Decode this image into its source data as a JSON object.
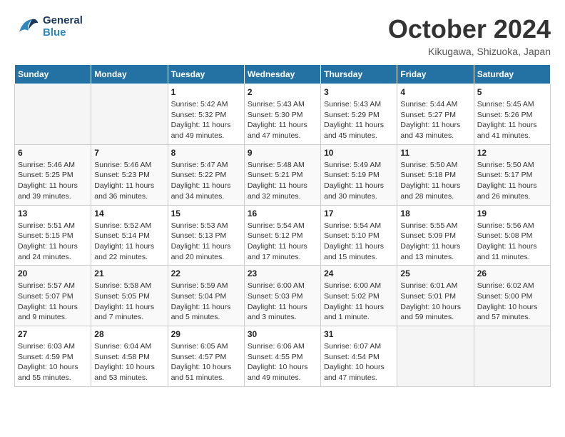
{
  "header": {
    "logo_general": "General",
    "logo_blue": "Blue",
    "title": "October 2024",
    "location": "Kikugawa, Shizuoka, Japan"
  },
  "weekdays": [
    "Sunday",
    "Monday",
    "Tuesday",
    "Wednesday",
    "Thursday",
    "Friday",
    "Saturday"
  ],
  "weeks": [
    [
      {
        "day": "",
        "info": ""
      },
      {
        "day": "",
        "info": ""
      },
      {
        "day": "1",
        "info": "Sunrise: 5:42 AM\nSunset: 5:32 PM\nDaylight: 11 hours and 49 minutes."
      },
      {
        "day": "2",
        "info": "Sunrise: 5:43 AM\nSunset: 5:30 PM\nDaylight: 11 hours and 47 minutes."
      },
      {
        "day": "3",
        "info": "Sunrise: 5:43 AM\nSunset: 5:29 PM\nDaylight: 11 hours and 45 minutes."
      },
      {
        "day": "4",
        "info": "Sunrise: 5:44 AM\nSunset: 5:27 PM\nDaylight: 11 hours and 43 minutes."
      },
      {
        "day": "5",
        "info": "Sunrise: 5:45 AM\nSunset: 5:26 PM\nDaylight: 11 hours and 41 minutes."
      }
    ],
    [
      {
        "day": "6",
        "info": "Sunrise: 5:46 AM\nSunset: 5:25 PM\nDaylight: 11 hours and 39 minutes."
      },
      {
        "day": "7",
        "info": "Sunrise: 5:46 AM\nSunset: 5:23 PM\nDaylight: 11 hours and 36 minutes."
      },
      {
        "day": "8",
        "info": "Sunrise: 5:47 AM\nSunset: 5:22 PM\nDaylight: 11 hours and 34 minutes."
      },
      {
        "day": "9",
        "info": "Sunrise: 5:48 AM\nSunset: 5:21 PM\nDaylight: 11 hours and 32 minutes."
      },
      {
        "day": "10",
        "info": "Sunrise: 5:49 AM\nSunset: 5:19 PM\nDaylight: 11 hours and 30 minutes."
      },
      {
        "day": "11",
        "info": "Sunrise: 5:50 AM\nSunset: 5:18 PM\nDaylight: 11 hours and 28 minutes."
      },
      {
        "day": "12",
        "info": "Sunrise: 5:50 AM\nSunset: 5:17 PM\nDaylight: 11 hours and 26 minutes."
      }
    ],
    [
      {
        "day": "13",
        "info": "Sunrise: 5:51 AM\nSunset: 5:15 PM\nDaylight: 11 hours and 24 minutes."
      },
      {
        "day": "14",
        "info": "Sunrise: 5:52 AM\nSunset: 5:14 PM\nDaylight: 11 hours and 22 minutes."
      },
      {
        "day": "15",
        "info": "Sunrise: 5:53 AM\nSunset: 5:13 PM\nDaylight: 11 hours and 20 minutes."
      },
      {
        "day": "16",
        "info": "Sunrise: 5:54 AM\nSunset: 5:12 PM\nDaylight: 11 hours and 17 minutes."
      },
      {
        "day": "17",
        "info": "Sunrise: 5:54 AM\nSunset: 5:10 PM\nDaylight: 11 hours and 15 minutes."
      },
      {
        "day": "18",
        "info": "Sunrise: 5:55 AM\nSunset: 5:09 PM\nDaylight: 11 hours and 13 minutes."
      },
      {
        "day": "19",
        "info": "Sunrise: 5:56 AM\nSunset: 5:08 PM\nDaylight: 11 hours and 11 minutes."
      }
    ],
    [
      {
        "day": "20",
        "info": "Sunrise: 5:57 AM\nSunset: 5:07 PM\nDaylight: 11 hours and 9 minutes."
      },
      {
        "day": "21",
        "info": "Sunrise: 5:58 AM\nSunset: 5:05 PM\nDaylight: 11 hours and 7 minutes."
      },
      {
        "day": "22",
        "info": "Sunrise: 5:59 AM\nSunset: 5:04 PM\nDaylight: 11 hours and 5 minutes."
      },
      {
        "day": "23",
        "info": "Sunrise: 6:00 AM\nSunset: 5:03 PM\nDaylight: 11 hours and 3 minutes."
      },
      {
        "day": "24",
        "info": "Sunrise: 6:00 AM\nSunset: 5:02 PM\nDaylight: 11 hours and 1 minute."
      },
      {
        "day": "25",
        "info": "Sunrise: 6:01 AM\nSunset: 5:01 PM\nDaylight: 10 hours and 59 minutes."
      },
      {
        "day": "26",
        "info": "Sunrise: 6:02 AM\nSunset: 5:00 PM\nDaylight: 10 hours and 57 minutes."
      }
    ],
    [
      {
        "day": "27",
        "info": "Sunrise: 6:03 AM\nSunset: 4:59 PM\nDaylight: 10 hours and 55 minutes."
      },
      {
        "day": "28",
        "info": "Sunrise: 6:04 AM\nSunset: 4:58 PM\nDaylight: 10 hours and 53 minutes."
      },
      {
        "day": "29",
        "info": "Sunrise: 6:05 AM\nSunset: 4:57 PM\nDaylight: 10 hours and 51 minutes."
      },
      {
        "day": "30",
        "info": "Sunrise: 6:06 AM\nSunset: 4:55 PM\nDaylight: 10 hours and 49 minutes."
      },
      {
        "day": "31",
        "info": "Sunrise: 6:07 AM\nSunset: 4:54 PM\nDaylight: 10 hours and 47 minutes."
      },
      {
        "day": "",
        "info": ""
      },
      {
        "day": "",
        "info": ""
      }
    ]
  ]
}
